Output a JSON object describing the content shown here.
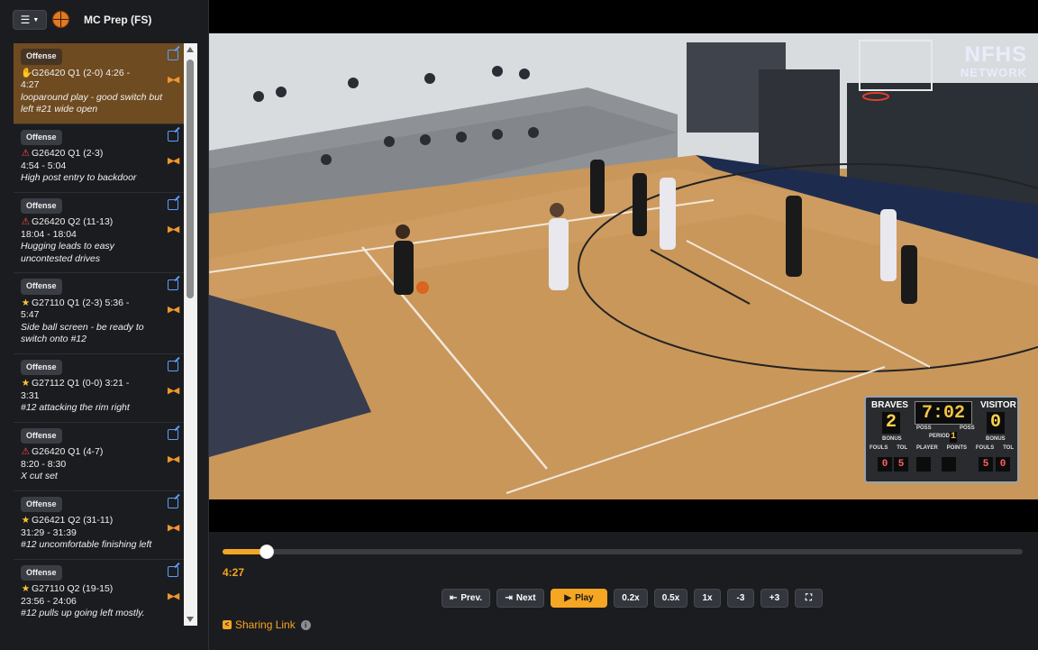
{
  "header": {
    "menu_icon": "hamburger-menu-icon",
    "team_icon": "basketball-icon",
    "title": "MC Prep (FS)"
  },
  "clips": [
    {
      "tag": "Offense",
      "icon": "thumbs-down-icon",
      "line1": "G26420 Q1 (2-0) 4:26 -",
      "line2": "4:27",
      "note": "looparound play - good switch but left #21 wide open",
      "active": true
    },
    {
      "tag": "Offense",
      "icon": "warning-icon",
      "line1": "G26420 Q1 (2-3)",
      "line2": "4:54 - 5:04",
      "note": "High post entry to backdoor",
      "active": false
    },
    {
      "tag": "Offense",
      "icon": "warning-icon",
      "line1": "G26420 Q2 (11-13)",
      "line2": "18:04 - 18:04",
      "note": "Hugging leads to easy uncontested drives",
      "active": false
    },
    {
      "tag": "Offense",
      "icon": "star-icon",
      "line1": "G27110 Q1 (2-3) 5:36 -",
      "line2": "5:47",
      "note": "Side ball screen - be ready to switch onto #12",
      "active": false
    },
    {
      "tag": "Offense",
      "icon": "star-icon",
      "line1": "G27112 Q1 (0-0) 3:21 -",
      "line2": "3:31",
      "note": "#12 attacking the rim right",
      "active": false
    },
    {
      "tag": "Offense",
      "icon": "warning-icon",
      "line1": "G26420 Q1 (4-7)",
      "line2": "8:20 - 8:30",
      "note": "X cut set",
      "active": false
    },
    {
      "tag": "Offense",
      "icon": "star-icon",
      "line1": "G26421 Q2 (31-11)",
      "line2": "31:29 - 31:39",
      "note": "#12 uncomfortable finishing left",
      "active": false
    },
    {
      "tag": "Offense",
      "icon": "star-icon",
      "line1": "G27110 Q2 (19-15)",
      "line2": "23:56 - 24:06",
      "note": "#12 pulls up going left mostly.",
      "active": false
    }
  ],
  "video": {
    "watermark_top": "NFHS",
    "watermark_bottom": "NETWORK",
    "scoreboard": {
      "home_label": "BRAVES",
      "visitor_label": "VISITOR",
      "home_score": "2",
      "visitor_score": "0",
      "clock": "7:02",
      "period_label": "PERIOD",
      "period": "1",
      "bonus_label": "BONUS",
      "poss_label": "POSS",
      "row_labels": [
        "FOULS",
        "TOL",
        "PLAYER",
        "POINTS",
        "FOULS",
        "TOL"
      ],
      "home_fouls": "0",
      "home_tol": "5",
      "visitor_fouls": "5",
      "visitor_tol": "0"
    }
  },
  "player": {
    "progress": 0.055,
    "current_time": "4:27",
    "buttons": {
      "prev": "Prev.",
      "next": "Next",
      "play": "Play",
      "speed_02": "0.2x",
      "speed_05": "0.5x",
      "speed_1": "1x",
      "back3": "-3",
      "fwd3": "+3"
    },
    "share_label": "Sharing Link"
  },
  "colors": {
    "accent": "#f5a623",
    "active_item": "#6e4b20",
    "edit_icon": "#5aa0ff",
    "warning": "#ff4d4d",
    "star": "#ffc634"
  }
}
